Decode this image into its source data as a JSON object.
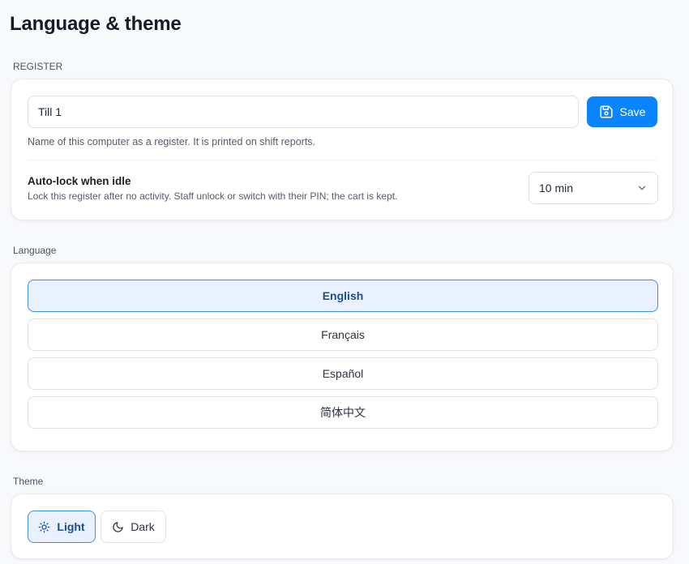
{
  "page": {
    "title": "Language & theme"
  },
  "register": {
    "section_label": "REGISTER",
    "name_value": "Till 1",
    "save_label": "Save",
    "name_hint": "Name of this computer as a register. It is printed on shift reports.",
    "autolock": {
      "title": "Auto-lock when idle",
      "description": "Lock this register after no activity. Staff unlock or switch with their PIN; the cart is kept.",
      "selected": "10 min"
    }
  },
  "language": {
    "section_label": "Language",
    "options": [
      {
        "label": "English",
        "selected": true
      },
      {
        "label": "Français",
        "selected": false
      },
      {
        "label": "Español",
        "selected": false
      },
      {
        "label": "简体中文",
        "selected": false
      }
    ]
  },
  "theme": {
    "section_label": "Theme",
    "options": [
      {
        "label": "Light",
        "icon": "sun-icon",
        "selected": true
      },
      {
        "label": "Dark",
        "icon": "moon-icon",
        "selected": false
      }
    ]
  },
  "colors": {
    "accent": "#0a84ff",
    "selected_bg": "#e8f1fd",
    "selected_border": "#3d8fe0",
    "page_bg": "#f8f9fb"
  }
}
